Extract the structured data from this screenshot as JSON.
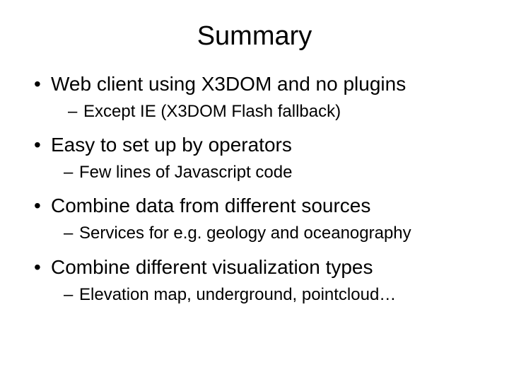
{
  "title": "Summary",
  "items": [
    {
      "text": "Web client using X3DOM and no plugins",
      "sub": " Except IE (X3DOM Flash fallback)",
      "sub_indent": "wide"
    },
    {
      "text": "Easy to set up by operators",
      "sub": "Few lines of Javascript code",
      "sub_indent": "tight"
    },
    {
      "text": "Combine data from different sources",
      "sub": "Services for e.g. geology and oceanography",
      "sub_indent": "tight"
    },
    {
      "text": "Combine different visualization types",
      "sub": "Elevation map, underground, pointcloud…",
      "sub_indent": "tight"
    }
  ],
  "bullet_char": "•",
  "dash_char": "–"
}
